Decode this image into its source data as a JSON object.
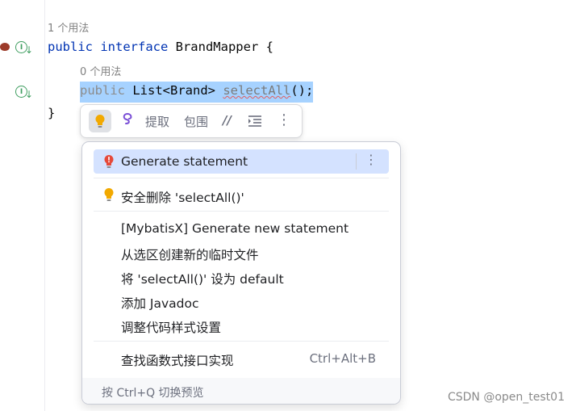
{
  "editor": {
    "usage1": "1 个用法",
    "usage2": "0 个用法",
    "line1_kw": "public interface",
    "line1_rest": " BrandMapper {",
    "line2_kw": "public",
    "line2_type": " List<Brand> ",
    "line2_method": "selectAll",
    "line2_end": "();",
    "line3": "}",
    "gutter_icon_label": "I"
  },
  "toolbar": {
    "extract": "提取",
    "surround": "包围",
    "comment_glyph": "//",
    "more_glyph": "⋮"
  },
  "popup": {
    "items": [
      {
        "label": "Generate statement"
      },
      {
        "label": "安全删除 'selectAll()'"
      },
      {
        "label": "[MybatisX] Generate new statement"
      },
      {
        "label": "从选区创建新的临时文件"
      },
      {
        "label": "将 'selectAll()' 设为 default"
      },
      {
        "label": "添加 Javadoc"
      },
      {
        "label": "调整代码样式设置"
      },
      {
        "label": "查找函数式接口实现",
        "shortcut": "Ctrl+Alt+B"
      }
    ],
    "footer": "按 Ctrl+Q 切换预览",
    "more_glyph": "⋮"
  },
  "watermark": "CSDN @open_test01",
  "colors": {
    "selection": "#a6d2ff",
    "keyword": "#0033b3",
    "popup_selected": "#d4e2ff"
  }
}
